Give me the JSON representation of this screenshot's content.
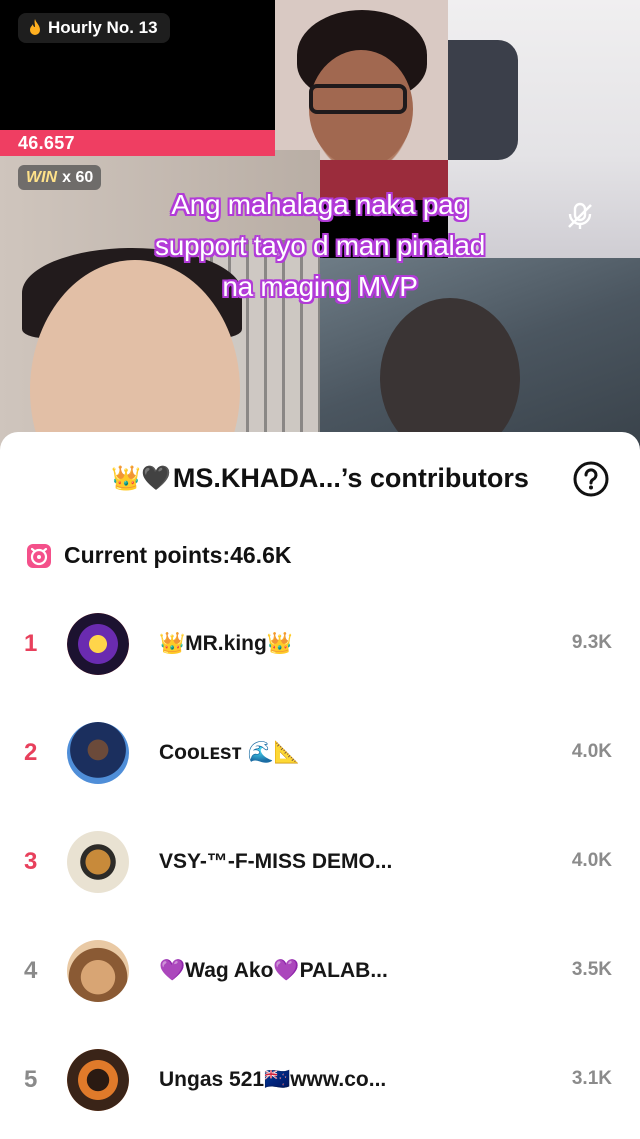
{
  "stream": {
    "hourly_badge": "Hourly No. 13",
    "score": "46.657",
    "win_label": "WIN",
    "win_count": "x 60",
    "caption_lines": [
      "Ang mahalaga naka pag",
      "support tayo d man pinalad",
      "na maging MVP"
    ]
  },
  "sheet": {
    "title_prefix": "👑🖤",
    "title": "MS.KHADA...’s contributors",
    "points_label": "Current points:46.6K"
  },
  "contributors": [
    {
      "rank": "1",
      "name": "👑MR.king👑",
      "score": "9.3K"
    },
    {
      "rank": "2",
      "name": "Cᴏᴏʟᴇsᴛ 🌊📐",
      "score": "4.0K"
    },
    {
      "rank": "3",
      "name": "VSY-™-F-MISS DEMO...",
      "score": "4.0K"
    },
    {
      "rank": "4",
      "name": "💜Wag Ako💜PALAB...",
      "score": "3.5K"
    },
    {
      "rank": "5",
      "name": "Ungas 521🇳🇿www.co...",
      "score": "3.1K"
    }
  ],
  "colors": {
    "accent": "#ef3e62",
    "rank_top": "#e8405c",
    "rank_other": "#8a8a8a",
    "caption_outline": "#b23bd8"
  }
}
